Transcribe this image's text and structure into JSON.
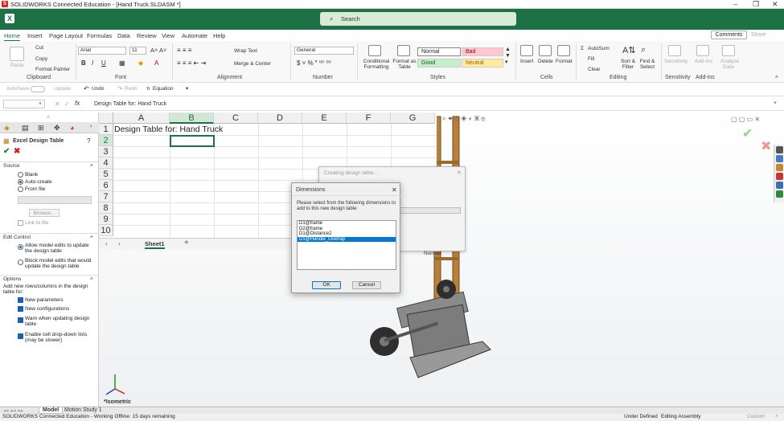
{
  "window": {
    "title": "SOLIDWORKS Connected Education - [Hand Truck.SLDASM *]",
    "controls": [
      "–",
      "❐",
      "✕"
    ]
  },
  "excel": {
    "search_placeholder": "Search",
    "menu": [
      "Home",
      "Insert",
      "Page Layout",
      "Formulas",
      "Data",
      "Review",
      "View",
      "Automate",
      "Help"
    ],
    "comments_label": "Comments",
    "share_label": "Share",
    "ribbon": {
      "clipboard": {
        "paste": "Paste",
        "cut": "Cut",
        "copy": "Copy",
        "format_painter": "Format Painter",
        "label": "Clipboard"
      },
      "font": {
        "name": "Arial",
        "size": "11",
        "label": "Font"
      },
      "alignment": {
        "wrap": "Wrap Text",
        "merge": "Merge & Center",
        "label": "Alignment"
      },
      "number": {
        "format": "General",
        "label": "Number"
      },
      "styles": {
        "conditional": "Conditional Formatting",
        "format_as_table": "Format as Table",
        "normal": "Normal",
        "bad": "Bad",
        "good": "Good",
        "neutral": "Neutral",
        "label": "Styles"
      },
      "cells": {
        "insert": "Insert",
        "delete": "Delete",
        "format": "Format",
        "label": "Cells"
      },
      "editing": {
        "autosum": "AutoSum",
        "fill": "Fill",
        "clear": "Clear",
        "sort": "Sort & Filter",
        "find": "Find & Select",
        "label": "Editing"
      },
      "sensitivity": {
        "btn": "Sensitivity",
        "label": "Sensitivity"
      },
      "addins": {
        "btn": "Add-ins",
        "label": "Add-ins"
      },
      "analyze": {
        "btn": "Analyze Data"
      }
    },
    "quickbar": {
      "autosave": "AutoSave",
      "update": "Update",
      "undo": "Undo",
      "redo": "Redo",
      "equation": "Equation"
    },
    "formula": {
      "namebox": "",
      "content": "Design Table for: Hand Truck"
    },
    "columns": [
      "A",
      "B",
      "C",
      "D",
      "E",
      "F",
      "G"
    ],
    "rows": [
      "1",
      "2",
      "3",
      "4",
      "5",
      "6",
      "7",
      "8",
      "9",
      "10"
    ],
    "cell_a1": "Design Table for: Hand Truck",
    "sheet_tab": "Sheet1"
  },
  "feature_manager": {
    "title": "Excel Design Table",
    "source_header": "Source",
    "source_options": [
      "Blank",
      "Auto-create",
      "From file"
    ],
    "browse": "Browse...",
    "link_to_file": "Link to file",
    "edit_control_header": "Edit Control",
    "edit_options": [
      "Allow model edits to update the design table",
      "Block model edits that would update the design table"
    ],
    "options_header": "Options",
    "options_intro": "Add new rows/columns in the design table for:",
    "option_items": [
      "New parameters",
      "New configurations",
      "Warn when updating design table",
      "Enable cell drop-down lists (may be slower)"
    ]
  },
  "creating_dialog": {
    "title": "Creating design table..."
  },
  "dimensions_dialog": {
    "title": "Dimensions",
    "prompt": "Please select from the following dimensions to add to this new design table:",
    "items": [
      "D1@frame",
      "D2@frame",
      "D1@Distance2",
      "D1@Handle_Overlap"
    ],
    "selected_index": 3,
    "ok": "OK",
    "cancel": "Cancel"
  },
  "view": {
    "orientation": "*Isometric",
    "normal_label": "Normal"
  },
  "bottom_tabs": [
    "Model",
    "Motion Study 1"
  ],
  "status": {
    "left": "SOLIDWORKS Connected Education - Working Offline: 15 days remaining",
    "under_defined": "Under Defined",
    "editing": "Editing Assembly",
    "custom": "Custom"
  }
}
